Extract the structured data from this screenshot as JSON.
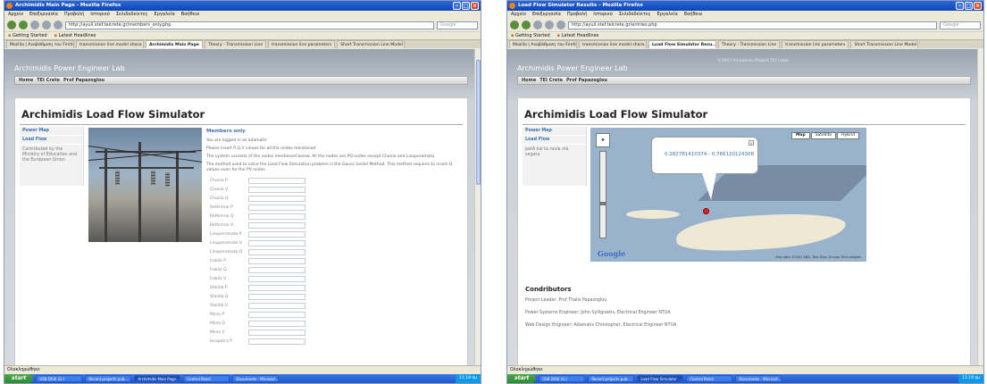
{
  "left": {
    "window_title": "Archimidis Main Page - Mozilla Firefox",
    "menu": [
      "Αρχείο",
      "Επεξεργασία",
      "Προβολή",
      "Ιστορικό",
      "Σελιδοδείκτες",
      "Εργαλεία",
      "Βοήθεια"
    ],
    "url": "http://ayuil.stef.teicrete.gr/members_only.php",
    "search_placeholder": "Google",
    "bookmarks": [
      "Getting Started",
      "Latest Headlines"
    ],
    "tabs": [
      "Mozilla | Αναβάθμιση του Firefox",
      "transmission line model shara...",
      "Archimidis Main Page",
      "Theory - Transmission Line",
      "transmission line parameters",
      "Short Transmission Line Model"
    ],
    "active_tab": 2,
    "lab_title": "Archimidis Power Engineer Lab",
    "site_nav": [
      "Home",
      "TEI Crete",
      "Prof Papazoglou"
    ],
    "page_title": "Archimidis Load Flow Simulator",
    "leftnav": [
      "Power Map",
      "Load Flow"
    ],
    "leftnav_note": "Contributed by the Ministry of Education and the European Union",
    "members_heading": "Members only",
    "paragraphs": [
      "You are logged in as adamatis",
      "Please insert P,Q,V values for all the nodes mentioned",
      "The system consists of the nodes mentioned below. All the nodes are PQ nodes except Chania and Linoperamata",
      "The method used to solve the Load Flow Simulation problem is the Gauss Seidel Method. This method requires to insert Q values even for the PV nodes"
    ],
    "fields": [
      "Chania P",
      "Chania V",
      "Chania Q",
      "Rethimno P",
      "Rethimno Q",
      "Rethimno V",
      "Linoperamata P",
      "Linoperamata V",
      "Linoperamata Q",
      "Iraklio P",
      "Iraklio Q",
      "Iraklio V",
      "Stalida P",
      "Stalida Q",
      "Stalida V",
      "Mires P",
      "Mires Q",
      "Mires V",
      "Ierapetra P"
    ],
    "status": "Ολοκληρώθηκε",
    "start_label": "start",
    "tasks": [
      "USB DISK (G:)",
      "Recent projects pub...",
      "Archimidis Main Page...",
      "Control Panel",
      "Documents - Microsof..."
    ],
    "active_task": 2,
    "clock": "11:18 πμ"
  },
  "right": {
    "window_title": "Load Flow Simulator Results - Mozilla Firefox",
    "menu": [
      "Αρχείο",
      "Επεξεργασία",
      "Προβολή",
      "Ιστορικό",
      "Σελιδοδείκτες",
      "Εργαλεία",
      "Βοήθεια"
    ],
    "url": "http://ayuil.stef.teicrete.gr/entries.php",
    "search_placeholder": "Google",
    "bookmarks": [
      "Getting Started",
      "Latest Headlines"
    ],
    "tabs": [
      "Mozilla | Αναβάθμιση του Firefox",
      "transmission line model shara...",
      "Load Flow Simulator Resu...",
      "Theory - Transmission Line",
      "transmission line parameters",
      "Short Transmission Line Model"
    ],
    "active_tab": 2,
    "lab_title": "Archimidis Power Engineer Lab",
    "copyright": "©2007 Archimidis Project TEI Crete",
    "site_nav": [
      "Home",
      "TEI Crete",
      "Prof Papazoglou"
    ],
    "page_title": "Archimidis Load Flow Simulator",
    "leftnav": [
      "Power Map",
      "Load Flow"
    ],
    "leftnav_note": "patA kai ta roula sta segata",
    "map_buttons": [
      "Map",
      "Satellite",
      "Hybrid"
    ],
    "active_map_button": 0,
    "coords": "0.282781410374 - 0.766120124308",
    "google_logo": "Google",
    "map_copyright": "Map data ©2007 AND, Tele Atlas, Europa Technologies",
    "contrib_heading": "Condributors",
    "contributors": [
      "Project Leader: Prof Thalis Papazoglou",
      "Power Systems Engineer: John Syllignakis, Electrical Engineer NTUA",
      "Web Design Engineer: Adamatis Christopher, Electrical Engineer NTUA"
    ],
    "status": "Ολοκληρώθηκε",
    "start_label": "start",
    "tasks": [
      "USB DISK (G:)",
      "Recent projects pub...",
      "Load Flow Simulator ...",
      "Control Panel",
      "Documents - Microsof..."
    ],
    "active_task": 2,
    "clock": "11:19 πμ"
  }
}
